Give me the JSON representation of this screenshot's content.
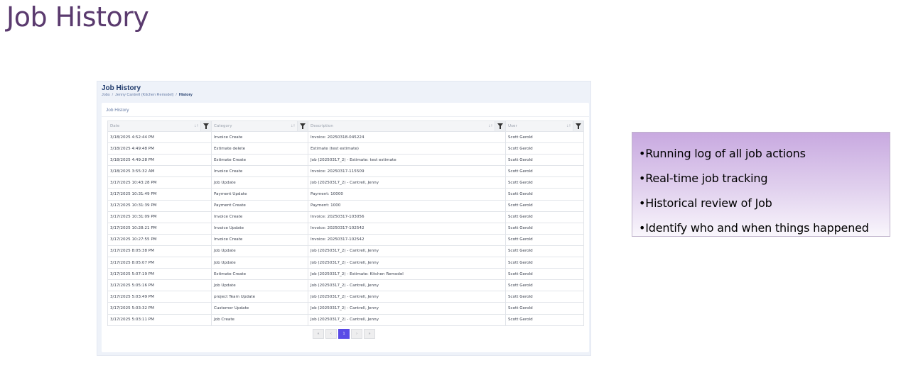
{
  "slide": {
    "title": "Job History"
  },
  "screenshot": {
    "title": "Job History",
    "breadcrumb": [
      "Jobs",
      "Jenny Cantrell (Kitchen Remodel)",
      "History"
    ],
    "breadcrumb_sep": "/",
    "card_title": "Job History",
    "sort_glyph": "↓↑",
    "columns": [
      {
        "label": "Date"
      },
      {
        "label": "Category"
      },
      {
        "label": "Description"
      },
      {
        "label": "User"
      }
    ],
    "rows": [
      [
        "3/18/2025 4:52:44 PM",
        "Invoice Create",
        "Invoice: 20250318-045224",
        "Scott Gerold"
      ],
      [
        "3/18/2025 4:49:48 PM",
        "Estimate delete",
        "Estimate (test estimate)",
        "Scott Gerold"
      ],
      [
        "3/18/2025 4:49:28 PM",
        "Estimate Create",
        "Job (20250317_2) - Estimate: test estimate",
        "Scott Gerold"
      ],
      [
        "3/18/2025 3:55:32 AM",
        "Invoice Create",
        "Invoice: 20250317-115509",
        "Scott Gerold"
      ],
      [
        "3/17/2025 10:43:28 PM",
        "Job Update",
        "Job (20250317_2) - Cantrell, Jenny",
        "Scott Gerold"
      ],
      [
        "3/17/2025 10:31:49 PM",
        "Payment Update",
        "Payment: 10000",
        "Scott Gerold"
      ],
      [
        "3/17/2025 10:31:39 PM",
        "Payment Create",
        "Payment: 1000",
        "Scott Gerold"
      ],
      [
        "3/17/2025 10:31:09 PM",
        "Invoice Create",
        "Invoice: 20250317-103056",
        "Scott Gerold"
      ],
      [
        "3/17/2025 10:28:21 PM",
        "Invoice Update",
        "Invoice: 20250317-102542",
        "Scott Gerold"
      ],
      [
        "3/17/2025 10:27:55 PM",
        "Invoice Create",
        "Invoice: 20250317-102542",
        "Scott Gerold"
      ],
      [
        "3/17/2025 8:05:38 PM",
        "Job Update",
        "Job (20250317_2) - Cantrell, Jenny",
        "Scott Gerold"
      ],
      [
        "3/17/2025 8:05:07 PM",
        "Job Update",
        "Job (20250317_2) - Cantrell, Jenny",
        "Scott Gerold"
      ],
      [
        "3/17/2025 5:07:19 PM",
        "Estimate Create",
        "Job (20250317_2) - Estimate: Kitchen Remodel",
        "Scott Gerold"
      ],
      [
        "3/17/2025 5:05:16 PM",
        "Job Update",
        "Job (20250317_2) - Cantrell, Jenny",
        "Scott Gerold"
      ],
      [
        "3/17/2025 5:03:49 PM",
        "project Team Update",
        "Job (20250317_2) - Cantrell, Jenny",
        "Scott Gerold"
      ],
      [
        "3/17/2025 5:03:32 PM",
        "Customer Update",
        "Job (20250317_2) - Cantrell, Jenny",
        "Scott Gerold"
      ],
      [
        "3/17/2025 5:03:11 PM",
        "Job Create",
        "Job (20250317_2) - Cantrell, Jenny",
        "Scott Gerold"
      ]
    ],
    "pagination": {
      "first": "«",
      "prev": "‹",
      "current": "1",
      "next": "›",
      "last": "»"
    }
  },
  "bullets": [
    "•Running log of all job actions",
    "•Real-time job tracking",
    "•Historical review of Job",
    "•Identify who and when things happened"
  ],
  "colors": {
    "title": "#5a3a6e",
    "accent": "#5a4be6",
    "bullet_box_top": "#c8a9e0"
  },
  "icons": {
    "filter": "filter-icon",
    "sort": "sort-icon"
  }
}
